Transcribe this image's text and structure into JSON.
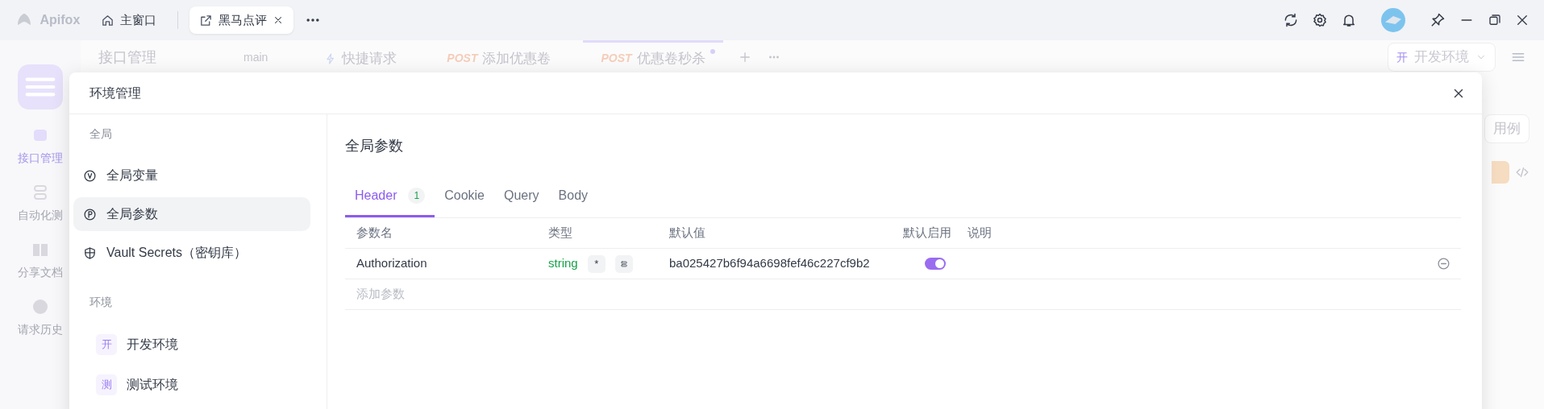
{
  "titlebar": {
    "app_name": "Apifox",
    "tabs": [
      {
        "label": "主窗口",
        "kind": "home",
        "selected": false,
        "closable": false
      },
      {
        "label": "黑马点评",
        "kind": "window",
        "selected": true,
        "closable": true
      }
    ]
  },
  "app": {
    "sidebar": [
      {
        "label": "接口管理",
        "kind": "api",
        "selected": true
      },
      {
        "label": "自动化测",
        "kind": "automation",
        "selected": false
      },
      {
        "label": "分享文档",
        "kind": "docs",
        "selected": false
      },
      {
        "label": "请求历史",
        "kind": "history",
        "selected": false
      }
    ],
    "header": {
      "title": "接口管理",
      "branch": "main"
    },
    "tabs": [
      {
        "label": "快捷请求",
        "selected": false,
        "unsaved": false
      },
      {
        "method": "POST",
        "label": "添加优惠卷",
        "selected": false,
        "unsaved": false
      },
      {
        "method": "POST",
        "label": "优惠卷秒杀",
        "selected": true,
        "unsaved": true
      }
    ],
    "environment": {
      "badge": "开",
      "label": "开发环境"
    },
    "side_button": "用例"
  },
  "modal": {
    "title": "环境管理",
    "nav_sections": [
      {
        "label": "全局",
        "items": [
          {
            "label": "全局变量",
            "kind": "variable",
            "selected": false
          },
          {
            "label": "全局参数",
            "kind": "parameter",
            "selected": true
          },
          {
            "label": "Vault Secrets（密钥库）",
            "kind": "vault",
            "selected": false
          }
        ]
      },
      {
        "label": "环境",
        "items": [
          {
            "label": "开发环境",
            "kind": "env",
            "badge": "开",
            "selected": false
          },
          {
            "label": "测试环境",
            "kind": "env",
            "badge": "测",
            "selected": false
          }
        ]
      }
    ],
    "content": {
      "title": "全局参数",
      "tabs": [
        {
          "label": "Header",
          "count": "1",
          "selected": true
        },
        {
          "label": "Cookie",
          "selected": false
        },
        {
          "label": "Query",
          "selected": false
        },
        {
          "label": "Body",
          "selected": false
        }
      ],
      "table": {
        "columns": [
          "参数名",
          "类型",
          "默认值",
          "默认启用",
          "说明"
        ],
        "rows": [
          {
            "name": "Authorization",
            "type": "string",
            "required_mark": "*",
            "default": "ba025427b6f94a6698fef46c227cf9b2",
            "enabled": true
          }
        ],
        "add_placeholder": "添加参数"
      }
    }
  }
}
